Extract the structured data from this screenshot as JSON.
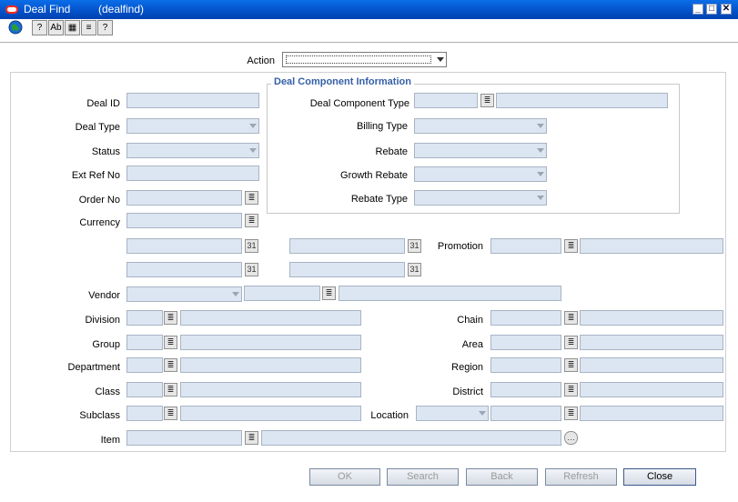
{
  "window": {
    "title": "Deal Find",
    "subtitle": "(dealfind)"
  },
  "toolbar": {
    "icons": [
      "globe-icon",
      "help-icon",
      "spellcheck-icon",
      "calculator-icon",
      "notepad-icon",
      "question-icon"
    ]
  },
  "action": {
    "label": "Action",
    "value": ""
  },
  "deal_component": {
    "title": "Deal Component Information",
    "type_label": "Deal Component Type",
    "billing_type_label": "Billing Type",
    "rebate_label": "Rebate",
    "growth_rebate_label": "Growth Rebate",
    "rebate_type_label": "Rebate Type"
  },
  "left": {
    "deal_id_label": "Deal ID",
    "deal_type_label": "Deal Type",
    "status_label": "Status",
    "ext_ref_no_label": "Ext Ref No",
    "order_no_label": "Order No",
    "currency_label": "Currency"
  },
  "promotion_label": "Promotion",
  "vendor_label": "Vendor",
  "hierarchy": {
    "division_label": "Division",
    "group_label": "Group",
    "department_label": "Department",
    "class_label": "Class",
    "subclass_label": "Subclass",
    "item_label": "Item"
  },
  "org": {
    "chain_label": "Chain",
    "area_label": "Area",
    "region_label": "Region",
    "district_label": "District",
    "location_label": "Location"
  },
  "buttons": {
    "ok": "OK",
    "search": "Search",
    "back": "Back",
    "refresh": "Refresh",
    "close": "Close"
  },
  "colors": {
    "titlebar": "#0350c8",
    "field_bg": "#dce6f2",
    "group_title": "#3560a8"
  }
}
